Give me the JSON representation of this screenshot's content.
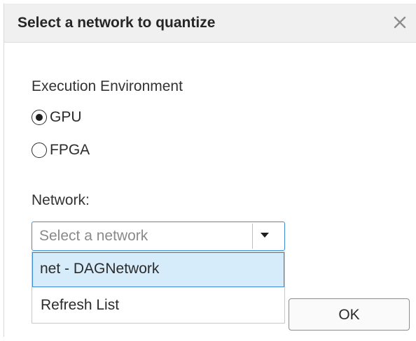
{
  "dialog": {
    "title": "Select a network to quantize",
    "close_icon": "close-icon"
  },
  "execution_environment": {
    "label": "Execution Environment",
    "options": [
      {
        "label": "GPU",
        "selected": true
      },
      {
        "label": "FPGA",
        "selected": false
      }
    ]
  },
  "network": {
    "label": "Network:",
    "placeholder": "Select a network",
    "dropdown_icon": "chevron-down-icon",
    "options": [
      {
        "label": "net - DAGNetwork",
        "highlighted": true
      },
      {
        "label": "Refresh List",
        "highlighted": false
      }
    ]
  },
  "footer": {
    "ok_label": "OK"
  },
  "colors": {
    "accent": "#3c8cd6",
    "highlight": "#d6ecfb",
    "titlebar": "#f0f0f0"
  }
}
